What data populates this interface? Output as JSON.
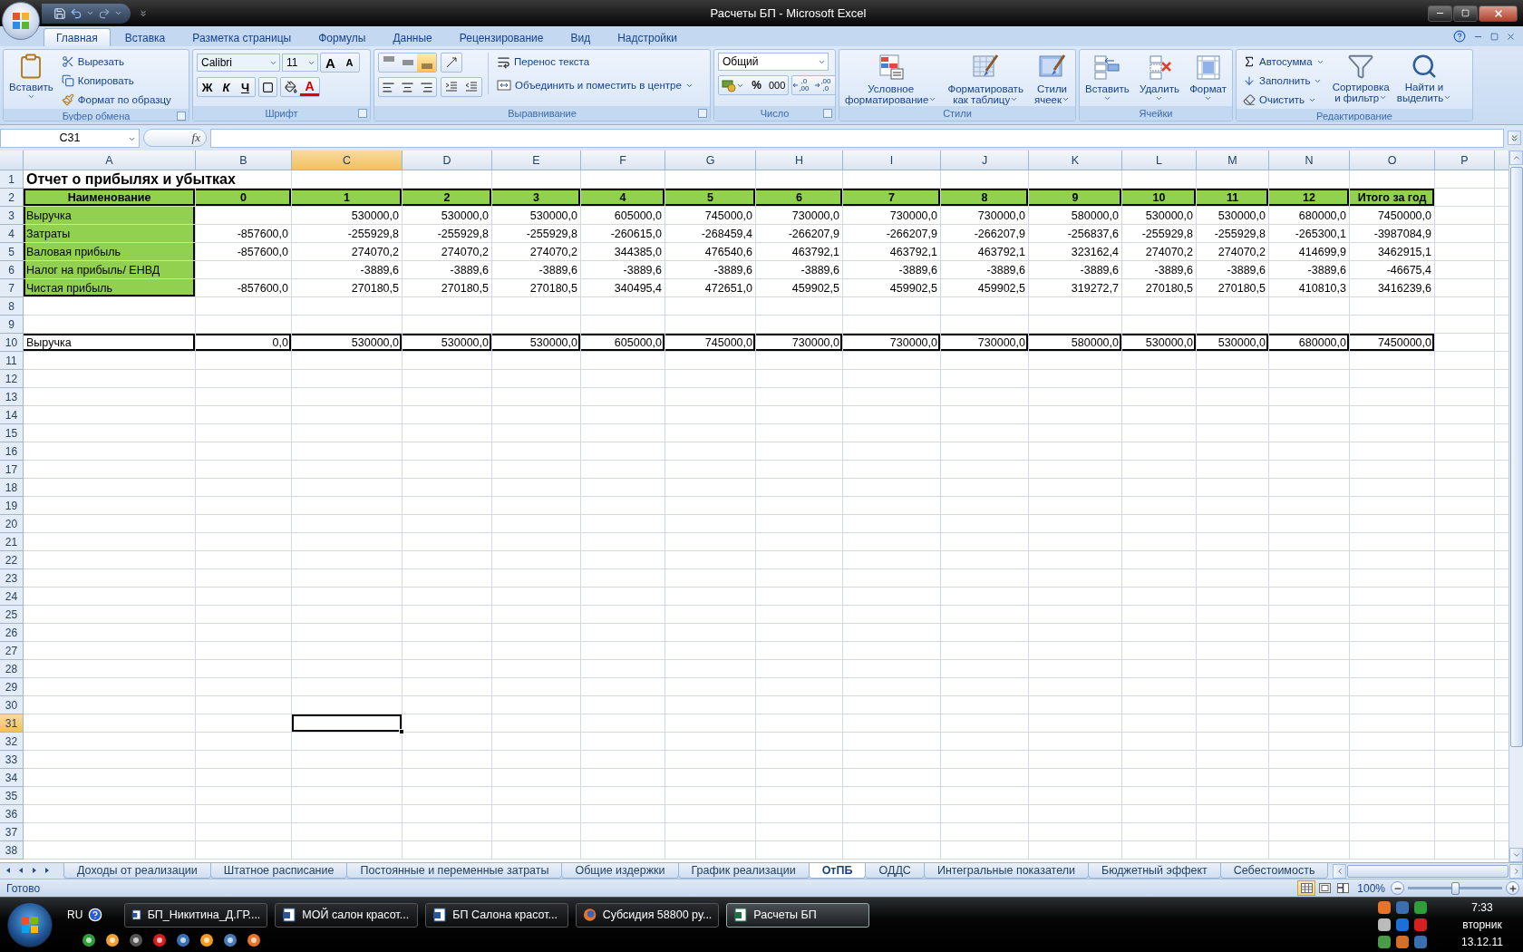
{
  "window": {
    "title": "Расчеты БП - Microsoft Excel"
  },
  "ribbon": {
    "tabs": [
      {
        "label": "Главная",
        "selected": true
      },
      {
        "label": "Вставка",
        "selected": false
      },
      {
        "label": "Разметка страницы",
        "selected": false
      },
      {
        "label": "Формулы",
        "selected": false
      },
      {
        "label": "Данные",
        "selected": false
      },
      {
        "label": "Рецензирование",
        "selected": false
      },
      {
        "label": "Вид",
        "selected": false
      },
      {
        "label": "Надстройки",
        "selected": false
      }
    ],
    "clipboard": {
      "label": "Буфер обмена",
      "paste": "Вставить",
      "items": [
        {
          "kind": "cut",
          "label": "Вырезать"
        },
        {
          "kind": "copy",
          "label": "Копировать"
        },
        {
          "kind": "format_painter",
          "label": "Формат по образцу"
        }
      ]
    },
    "font": {
      "label": "Шрифт",
      "name": "Calibri",
      "size": "11",
      "grow": "A",
      "shrink": "A",
      "styles": [
        {
          "kind": "bold",
          "label": "Ж"
        },
        {
          "kind": "italic",
          "label": "К"
        },
        {
          "kind": "underline",
          "label": "Ч"
        }
      ],
      "font_color": "A"
    },
    "alignment": {
      "label": "Выравнивание",
      "vertical": [
        {
          "kind": "top",
          "selected": false
        },
        {
          "kind": "middle",
          "selected": false
        },
        {
          "kind": "bottom",
          "selected": true
        }
      ],
      "horizontal": [
        {
          "kind": "left",
          "selected": false
        },
        {
          "kind": "center",
          "selected": false
        },
        {
          "kind": "right",
          "selected": false
        }
      ],
      "wrap": "Перенос текста",
      "merge": "Объединить и поместить в центре"
    },
    "number": {
      "label": "Число",
      "format": "Общий",
      "percent": "%",
      "thousands": "000",
      "decimals": [
        {
          "kind": "increase",
          "top": ",0",
          "bottom": ",00"
        },
        {
          "kind": "decrease",
          "top": ",00",
          "bottom": ",0"
        }
      ]
    },
    "styles": {
      "label": "Стили",
      "buttons": [
        {
          "kind": "conditional",
          "lines": [
            "Условное",
            "форматирование"
          ]
        },
        {
          "kind": "table",
          "lines": [
            "Форматировать",
            "как таблицу"
          ]
        },
        {
          "kind": "cell",
          "lines": [
            "Стили",
            "ячеек"
          ]
        }
      ]
    },
    "cells": {
      "label": "Ячейки",
      "buttons": [
        {
          "kind": "insert",
          "label": "Вставить"
        },
        {
          "kind": "delete",
          "label": "Удалить"
        },
        {
          "kind": "format",
          "label": "Формат"
        }
      ]
    },
    "editing": {
      "label": "Редактирование",
      "small": [
        {
          "kind": "sum",
          "label": "Автосумма"
        },
        {
          "kind": "fill",
          "label": "Заполнить"
        },
        {
          "kind": "clear",
          "label": "Очистить"
        }
      ],
      "big": [
        {
          "kind": "sort",
          "lines": [
            "Сортировка",
            "и фильтр"
          ]
        },
        {
          "kind": "find",
          "lines": [
            "Найти и",
            "выделить"
          ]
        }
      ]
    }
  },
  "formula_bar": {
    "name_box": "C31",
    "function_label": "fx"
  },
  "sheet": {
    "columns": [
      {
        "label": "A",
        "selected": false
      },
      {
        "label": "B",
        "selected": false
      },
      {
        "label": "C",
        "selected": true
      },
      {
        "label": "D",
        "selected": false
      },
      {
        "label": "E",
        "selected": false
      },
      {
        "label": "F",
        "selected": false
      },
      {
        "label": "G",
        "selected": false
      },
      {
        "label": "H",
        "selected": false
      },
      {
        "label": "I",
        "selected": false
      },
      {
        "label": "J",
        "selected": false
      },
      {
        "label": "K",
        "selected": false
      },
      {
        "label": "L",
        "selected": false
      },
      {
        "label": "M",
        "selected": false
      },
      {
        "label": "N",
        "selected": false
      },
      {
        "label": "O",
        "selected": false
      },
      {
        "label": "P",
        "selected": false
      }
    ],
    "rows": [
      {
        "number": "1",
        "selected": false,
        "kind": "title",
        "cells": [
          "Отчет о прибылях и убытках"
        ]
      },
      {
        "number": "2",
        "selected": false,
        "kind": "header",
        "cells": [
          "Наименование",
          "0",
          "1",
          "2",
          "3",
          "4",
          "5",
          "6",
          "7",
          "8",
          "9",
          "10",
          "11",
          "12",
          "Итого за год"
        ]
      },
      {
        "number": "3",
        "selected": false,
        "kind": "data",
        "cells": [
          "Выручка",
          null,
          "530000,0",
          "530000,0",
          "530000,0",
          "605000,0",
          "745000,0",
          "730000,0",
          "730000,0",
          "730000,0",
          "580000,0",
          "530000,0",
          "530000,0",
          "680000,0",
          "7450000,0"
        ]
      },
      {
        "number": "4",
        "selected": false,
        "kind": "data",
        "cells": [
          "Затраты",
          "-857600,0",
          "-255929,8",
          "-255929,8",
          "-255929,8",
          "-260615,0",
          "-268459,4",
          "-266207,9",
          "-266207,9",
          "-266207,9",
          "-256837,6",
          "-255929,8",
          "-255929,8",
          "-265300,1",
          "-3987084,9"
        ]
      },
      {
        "number": "5",
        "selected": false,
        "kind": "data",
        "cells": [
          "Валовая прибыль",
          "-857600,0",
          "274070,2",
          "274070,2",
          "274070,2",
          "344385,0",
          "476540,6",
          "463792,1",
          "463792,1",
          "463792,1",
          "323162,4",
          "274070,2",
          "274070,2",
          "414699,9",
          "3462915,1"
        ]
      },
      {
        "number": "6",
        "selected": false,
        "kind": "data",
        "cells": [
          "Налог на прибыль/ ЕНВД",
          null,
          "-3889,6",
          "-3889,6",
          "-3889,6",
          "-3889,6",
          "-3889,6",
          "-3889,6",
          "-3889,6",
          "-3889,6",
          "-3889,6",
          "-3889,6",
          "-3889,6",
          "-3889,6",
          "-46675,4"
        ]
      },
      {
        "number": "7",
        "selected": false,
        "kind": "data",
        "cells": [
          "Чистая прибыль",
          "-857600,0",
          "270180,5",
          "270180,5",
          "270180,5",
          "340495,4",
          "472651,0",
          "459902,5",
          "459902,5",
          "459902,5",
          "319272,7",
          "270180,5",
          "270180,5",
          "410810,3",
          "3416239,6"
        ]
      },
      {
        "number": "8",
        "selected": false
      },
      {
        "number": "9",
        "selected": false
      },
      {
        "number": "10",
        "selected": false,
        "kind": "total",
        "cells": [
          "Выручка",
          "0,0",
          "530000,0",
          "530000,0",
          "530000,0",
          "605000,0",
          "745000,0",
          "730000,0",
          "730000,0",
          "730000,0",
          "580000,0",
          "530000,0",
          "530000,0",
          "680000,0",
          "7450000,0"
        ]
      },
      {
        "number": "11",
        "selected": false
      },
      {
        "number": "12",
        "selected": false
      },
      {
        "number": "13",
        "selected": false
      },
      {
        "number": "14",
        "selected": false
      },
      {
        "number": "15",
        "selected": false
      },
      {
        "number": "16",
        "selected": false
      },
      {
        "number": "17",
        "selected": false
      },
      {
        "number": "18",
        "selected": false
      },
      {
        "number": "19",
        "selected": false
      },
      {
        "number": "20",
        "selected": false
      },
      {
        "number": "21",
        "selected": false
      },
      {
        "number": "22",
        "selected": false
      },
      {
        "number": "23",
        "selected": false
      },
      {
        "number": "24",
        "selected": false
      },
      {
        "number": "25",
        "selected": false
      },
      {
        "number": "26",
        "selected": false
      },
      {
        "number": "27",
        "selected": false
      },
      {
        "number": "28",
        "selected": false
      },
      {
        "number": "29",
        "selected": false
      },
      {
        "number": "30",
        "selected": false
      },
      {
        "number": "31",
        "selected": true
      },
      {
        "number": "32",
        "selected": false
      },
      {
        "number": "33",
        "selected": false
      },
      {
        "number": "34",
        "selected": false
      },
      {
        "number": "35",
        "selected": false
      },
      {
        "number": "36",
        "selected": false
      },
      {
        "number": "37",
        "selected": false
      },
      {
        "number": "38",
        "selected": false
      }
    ]
  },
  "sheet_tabs": [
    {
      "label": "Доходы от реализации",
      "selected": false
    },
    {
      "label": "Штатное расписание",
      "selected": false
    },
    {
      "label": "Постоянные и переменные затраты",
      "selected": false
    },
    {
      "label": "Общие издержки",
      "selected": false
    },
    {
      "label": "График реализации",
      "selected": false
    },
    {
      "label": "ОтПБ",
      "selected": true
    },
    {
      "label": "ОДДС",
      "selected": false
    },
    {
      "label": "Интегральные показатели",
      "selected": false
    },
    {
      "label": "Бюджетный эффект",
      "selected": false
    },
    {
      "label": "Себестоимость",
      "selected": false
    }
  ],
  "status_bar": {
    "status": "Готово",
    "views": [
      {
        "kind": "normal",
        "selected": true
      },
      {
        "kind": "layout",
        "selected": false
      },
      {
        "kind": "page_break",
        "selected": false
      }
    ],
    "zoom": "100%",
    "zoom_slider": {
      "level": 0.5
    }
  },
  "taskbar": {
    "language": "RU",
    "tasks": [
      {
        "kind": "word",
        "label": "БП_Никитина_Д.ГР....",
        "selected": false
      },
      {
        "kind": "word",
        "label": "МОЙ салон красот...",
        "selected": false
      },
      {
        "kind": "word",
        "label": "БП Салона красот...",
        "selected": false
      },
      {
        "kind": "browser",
        "label": "Субсидия 58800 ру...",
        "selected": false
      },
      {
        "kind": "excel",
        "label": "Расчеты БП",
        "selected": true
      }
    ],
    "clock": {
      "time": "7:33",
      "day": "вторник",
      "date": "13.12.11"
    }
  }
}
